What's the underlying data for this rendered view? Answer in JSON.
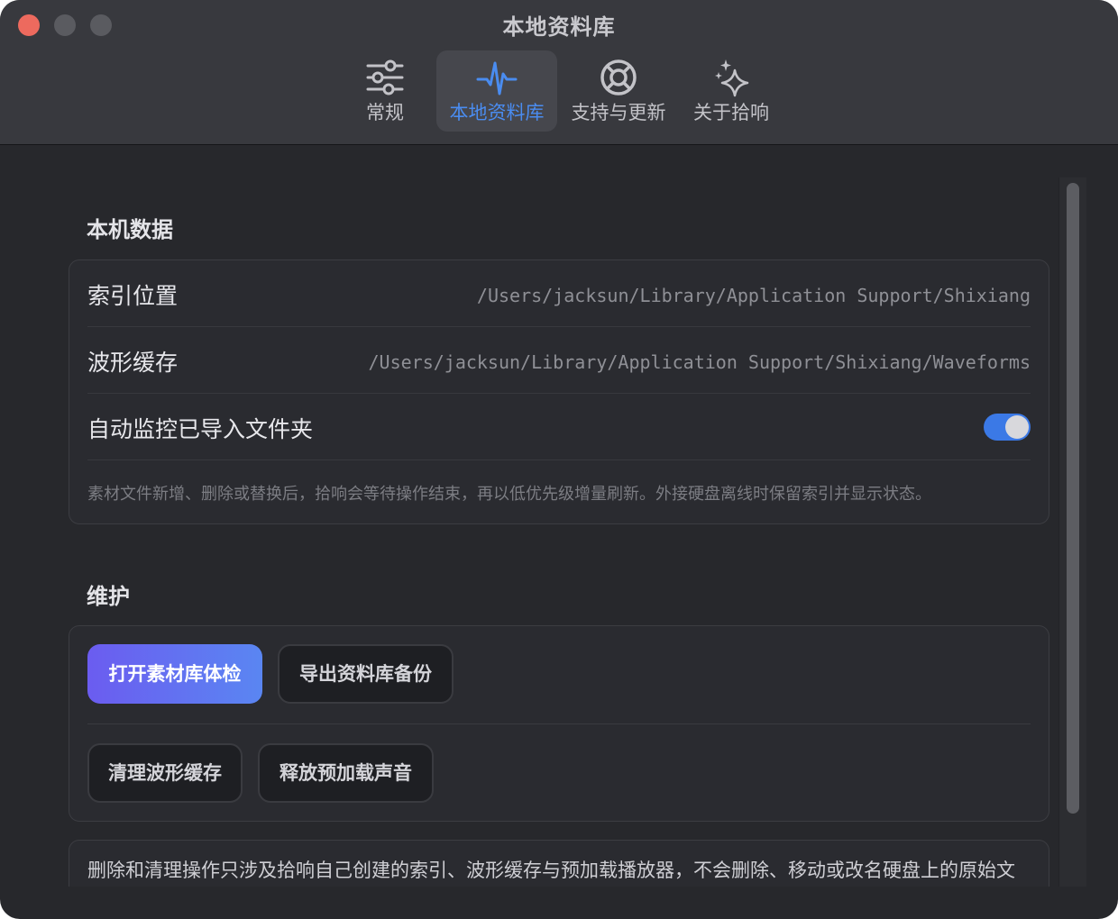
{
  "window": {
    "title": "本地资料库"
  },
  "tabs": [
    {
      "label": "常规",
      "icon": "sliders-icon"
    },
    {
      "label": "本地资料库",
      "icon": "waveform-icon",
      "active": true
    },
    {
      "label": "支持与更新",
      "icon": "lifebuoy-icon"
    },
    {
      "label": "关于拾响",
      "icon": "sparkles-icon"
    }
  ],
  "local_data": {
    "title": "本机数据",
    "index_label": "索引位置",
    "index_path": "/Users/jacksun/Library/Application Support/Shixiang",
    "waveform_label": "波形缓存",
    "waveform_path": "/Users/jacksun/Library/Application Support/Shixiang/Waveforms",
    "monitor_label": "自动监控已导入文件夹",
    "monitor_enabled": true,
    "hint": "素材文件新增、删除或替换后，拾响会等待操作结束，再以低优先级增量刷新。外接硬盘离线时保留索引并显示状态。"
  },
  "maintenance": {
    "title": "维护",
    "health_check_button": "打开素材库体检",
    "export_button": "导出资料库备份",
    "clear_cache_button": "清理波形缓存",
    "release_button": "释放预加载声音",
    "note": "删除和清理操作只涉及拾响自己创建的索引、波形缓存与预加载播放器，不会删除、移动或改名硬盘上的原始文件。"
  },
  "colors": {
    "accent": "#4a8cf0",
    "toggle_on": "#3b79e6",
    "primary_start": "#6b5cf0",
    "primary_end": "#5a86f2"
  }
}
